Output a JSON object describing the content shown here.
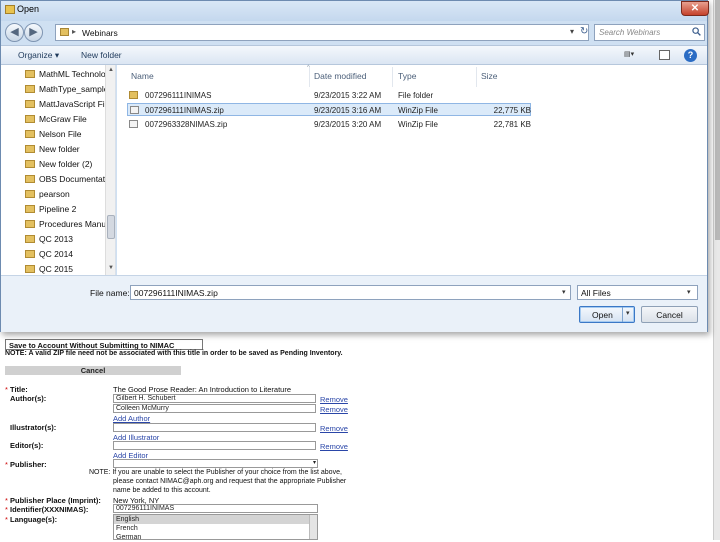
{
  "dialog": {
    "title": "Open",
    "close_glyph": "✕",
    "nav": {
      "back_glyph": "◀",
      "forward_glyph": "▶"
    },
    "address": {
      "separator": "▸",
      "path": "Webinars",
      "drop_glyph": "▾",
      "refresh_glyph": "↻"
    },
    "search": {
      "placeholder": "Search Webinars"
    },
    "toolbar": {
      "organize": "Organize ▾",
      "new_folder": "New folder",
      "view": "▤▾",
      "help": "?"
    },
    "sidebar": {
      "items": [
        "MathML Technolog",
        "MathType_sample",
        "MattJavaScript Fil",
        "McGraw File",
        "Nelson File",
        "New folder",
        "New folder (2)",
        "OBS Documentati",
        "pearson",
        "Pipeline 2",
        "Procedures Manu",
        "QC 2013",
        "QC 2014",
        "QC 2015"
      ],
      "scroll_up": "▲",
      "scroll_down": "▼"
    },
    "columns": {
      "name": "Name",
      "date": "Date modified",
      "type": "Type",
      "size": "Size",
      "sort_glyph": "^"
    },
    "files": [
      {
        "name": "007296111INIMAS",
        "date": "9/23/2015 3:22 AM",
        "type": "File folder",
        "size": "",
        "icon": "folder-icon",
        "selected": false
      },
      {
        "name": "007296111INIMAS.zip",
        "date": "9/23/2015 3:16 AM",
        "type": "WinZip File",
        "size": "22,775 KB",
        "icon": "zip-icon",
        "selected": true
      },
      {
        "name": "0072963328NIMAS.zip",
        "date": "9/23/2015 3:20 AM",
        "type": "WinZip File",
        "size": "22,781 KB",
        "icon": "zip-icon",
        "selected": false
      }
    ],
    "footer": {
      "filename_label": "File name:",
      "filename_value": "007296111INIMAS.zip",
      "filename_drop": "▾",
      "filetype_value": "All Files",
      "filetype_arrow": "▾",
      "open_label": "Open",
      "open_arrow": "▾",
      "cancel_label": "Cancel"
    }
  },
  "webform": {
    "save_heading": "Save to Account Without Submitting to NIMAC",
    "note": "NOTE: A valid ZIP file need not be associated with this title in order to be saved as Pending Inventory.",
    "cancel": "Cancel",
    "title_label": "Title:",
    "title_value": "The Good Prose Reader: An Introduction to Literature",
    "author_label": "Author(s):",
    "authors": [
      "Gilbert H. Schubert",
      "Colleen McMurry"
    ],
    "remove": "Remove",
    "add_author": "Add Author",
    "illustrator_label": "Illustrator(s):",
    "add_illustrator": "Add Illustrator",
    "editor_label": "Editor(s):",
    "add_editor": "Add Editor",
    "publisher_label": "Publisher:",
    "publisher_note_1": "NOTE: If you are unable to select the Publisher of your choice from the list above,",
    "publisher_note_2": "please contact NIMAC@aph.org and request that the appropriate Publisher",
    "publisher_note_3": "name be added to this account.",
    "pub_place_label": "Publisher Place (Imprint):",
    "pub_place_value": "New York, NY",
    "identifier_label": "Identifier(XXXNIMAS):",
    "identifier_value": "007296111INIMAS",
    "language_label": "Language(s):",
    "languages": [
      "English",
      "French",
      "German"
    ],
    "required_mark": "*"
  }
}
